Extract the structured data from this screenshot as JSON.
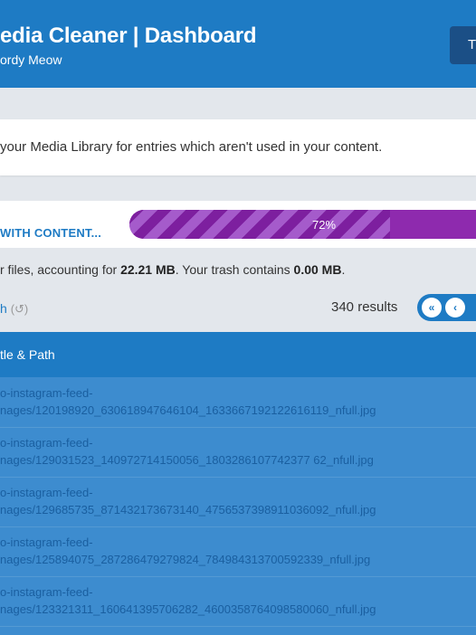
{
  "header": {
    "title": "edia Cleaner | Dashboard",
    "subtitle": "ordy Meow",
    "button_label": "T"
  },
  "info": {
    "text": "your Media Library for entries which aren't used in your content."
  },
  "progress": {
    "label": "WITH CONTENT...",
    "percent_text": "72%",
    "percent": 72
  },
  "summary": {
    "prefix": "r files, accounting for ",
    "size": "22.21 MB",
    "middle": ". Your trash contains ",
    "trash_size": "0.00 MB",
    "suffix": "."
  },
  "trash": {
    "link_text": "h",
    "count": "(↺)"
  },
  "results": {
    "count_text": "340 results"
  },
  "pager": {
    "first_icon": "«",
    "prev_icon": "‹"
  },
  "table": {
    "column_title": "tle & Path",
    "rows": [
      {
        "line1": "o-instagram-feed-",
        "line2": "nages/120198920_630618947646104_1633667192122616119_nfull.jpg"
      },
      {
        "line1": "o-instagram-feed-",
        "line2": "nages/129031523_140972714150056_1803286107742377 62_nfull.jpg"
      },
      {
        "line1": "o-instagram-feed-",
        "line2": "nages/129685735_871432173673140_4756537398911036092_nfull.jpg"
      },
      {
        "line1": "o-instagram-feed-",
        "line2": "nages/125894075_287286479279824_784984313700592339_nfull.jpg"
      },
      {
        "line1": "o-instagram-feed-",
        "line2": "nages/123321311_160641395706282_4600358764098580060_nfull.jpg"
      }
    ]
  },
  "colors": {
    "brand": "#1e7bc4",
    "progress": "#8e2aae",
    "table_body": "#3d8ccf"
  }
}
